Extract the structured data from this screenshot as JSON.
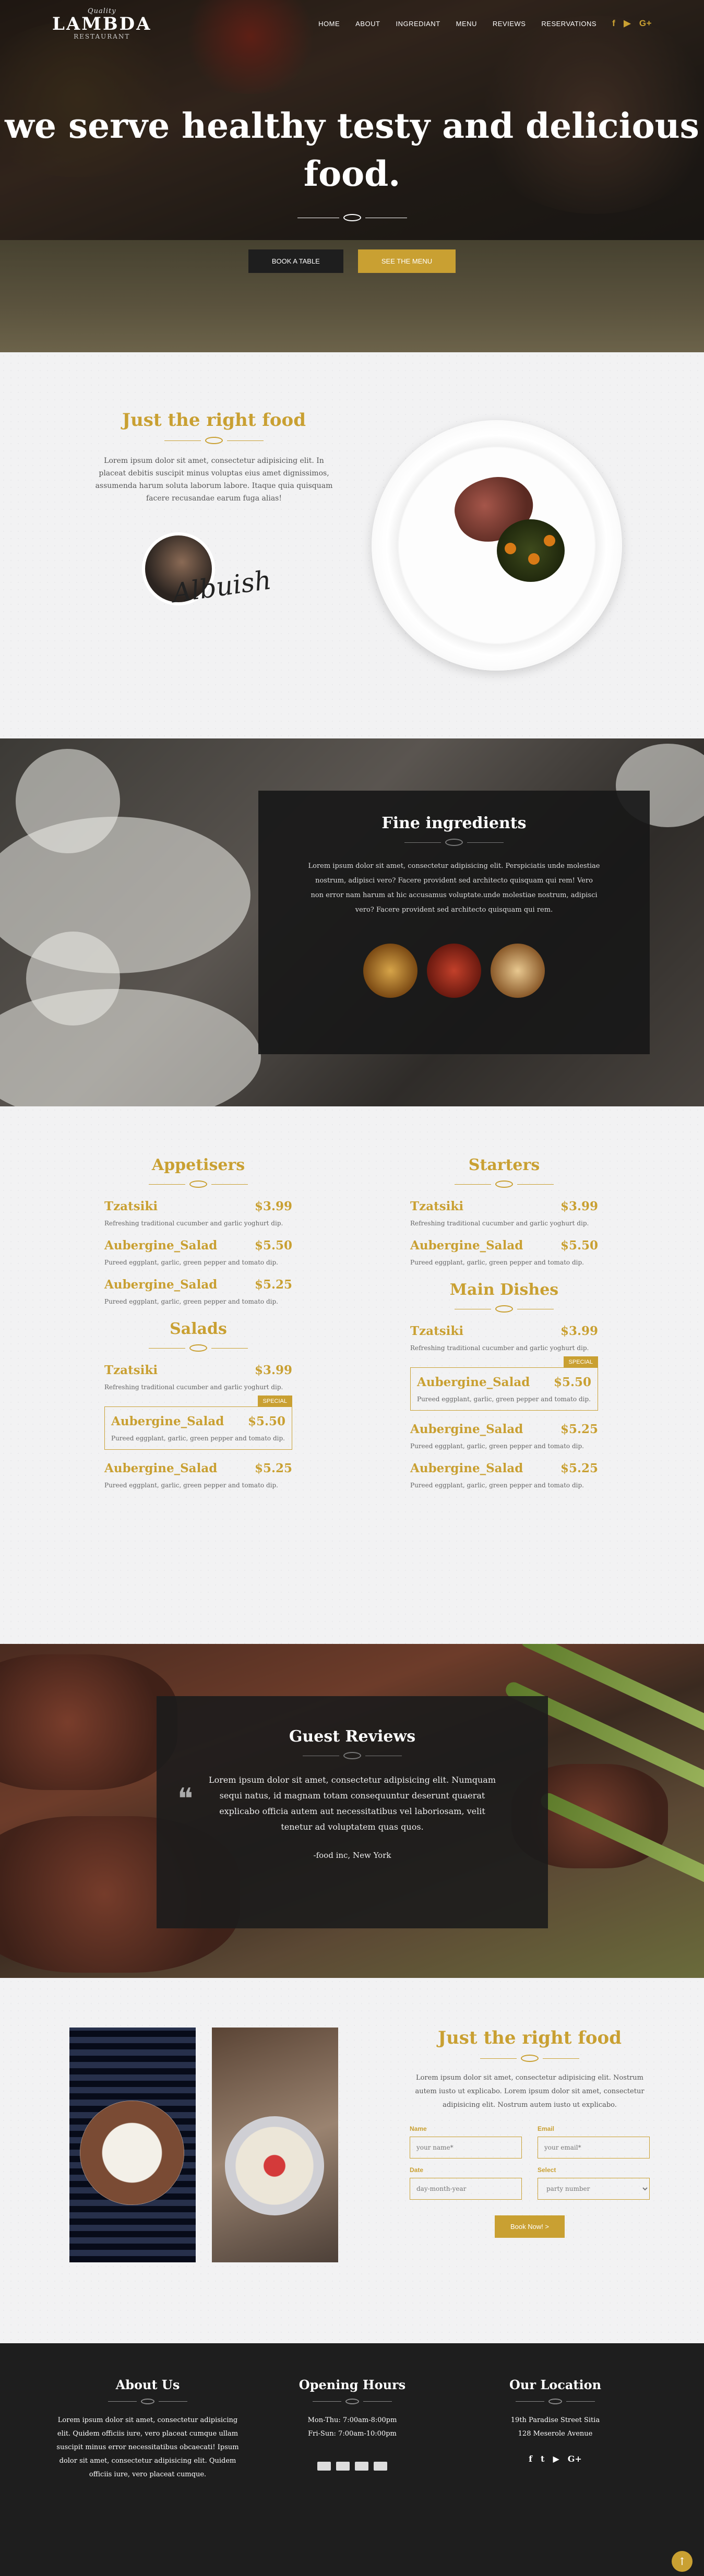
{
  "brand": {
    "sub1": "Quality",
    "name": "LAMBDA",
    "sub2": "RESTAURANT"
  },
  "nav": {
    "items": [
      "HOME",
      "ABOUT",
      "INGREDIANT",
      "MENU",
      "REVIEWS",
      "RESERVATIONS"
    ],
    "social": [
      "f",
      "▶",
      "G+"
    ]
  },
  "hero": {
    "title": "we serve healthy testy and delicious food.",
    "book_button": "BOOK A TABLE",
    "menu_button": "SEE THE MENU"
  },
  "about": {
    "title": "Just the right food",
    "text": "Lorem ipsum dolor sit amet, consectetur adipisicing elit. In placeat debitis suscipit minus voluptas eius amet dignissimos, assumenda harum soluta laborum labore. Itaque quia quisquam facere recusandae earum fuga alias!",
    "signature": "Albuish"
  },
  "ingredients": {
    "title": "Fine ingredients",
    "text": "Lorem ipsum dolor sit amet, consectetur adipisicing elit. Perspiciatis unde molestiae nostrum, adipisci vero? Facere provident sed architecto quisquam qui rem! Vero non error nam harum at hic accusamus voluptate.unde molestiae nostrum, adipisci vero? Facere provident sed architecto quisquam qui rem."
  },
  "menu": {
    "appetisers": {
      "title": "Appetisers",
      "items": [
        {
          "name": "Tzatsiki",
          "price": "$3.99",
          "desc": "Refreshing traditional cucumber and garlic yoghurt dip."
        },
        {
          "name": "Aubergine_Salad",
          "price": "$5.50",
          "desc": "Pureed eggplant, garlic, green pepper and tomato dip."
        },
        {
          "name": "Aubergine_Salad",
          "price": "$5.25",
          "desc": "Pureed eggplant, garlic, green pepper and tomato dip."
        }
      ]
    },
    "salads": {
      "title": "Salads",
      "items": [
        {
          "name": "Tzatsiki",
          "price": "$3.99",
          "desc": "Refreshing traditional cucumber and garlic yoghurt dip."
        },
        {
          "name": "Aubergine_Salad",
          "price": "$5.50",
          "desc": "Pureed eggplant, garlic, green pepper and tomato dip.",
          "tag": "SPECIAL"
        },
        {
          "name": "Aubergine_Salad",
          "price": "$5.25",
          "desc": "Pureed eggplant, garlic, green pepper and tomato dip."
        }
      ]
    },
    "starters": {
      "title": "Starters",
      "items": [
        {
          "name": "Tzatsiki",
          "price": "$3.99",
          "desc": "Refreshing traditional cucumber and garlic yoghurt dip."
        },
        {
          "name": "Aubergine_Salad",
          "price": "$5.50",
          "desc": "Pureed eggplant, garlic, green pepper and tomato dip."
        }
      ]
    },
    "main": {
      "title": "Main Dishes",
      "items": [
        {
          "name": "Tzatsiki",
          "price": "$3.99",
          "desc": "Refreshing traditional cucumber and garlic yoghurt dip."
        },
        {
          "name": "Aubergine_Salad",
          "price": "$5.50",
          "desc": "Pureed eggplant, garlic, green pepper and tomato dip.",
          "tag": "SPECIAL"
        },
        {
          "name": "Aubergine_Salad",
          "price": "$5.25",
          "desc": "Pureed eggplant, garlic, green pepper and tomato dip."
        },
        {
          "name": "Aubergine_Salad",
          "price": "$5.25",
          "desc": "Pureed eggplant, garlic, green pepper and tomato dip."
        }
      ]
    }
  },
  "reviews": {
    "title": "Guest Reviews",
    "quote_mark": "❝",
    "text": "Lorem ipsum dolor sit amet, consectetur adipisicing elit. Numquam sequi natus, id magnam totam consequuntur deserunt quaerat explicabo officia autem aut necessitatibus vel laboriosam, velit tenetur ad voluptatem quas quos.",
    "author": "-food inc, New York"
  },
  "booking": {
    "title": "Just the right food",
    "text": "Lorem ipsum dolor sit amet, consectetur adipisicing elit. Nostrum autem iusto ut explicabo. Lorem ipsum dolor sit amet, consectetur adipisicing elit. Nostrum autem iusto ut explicabo.",
    "name_label": "Name",
    "name_placeholder": "your name*",
    "email_label": "Email",
    "email_placeholder": "your email*",
    "date_label": "Date",
    "date_placeholder": "day-month-year",
    "select_label": "Select",
    "select_value": "party number",
    "submit": "Book Now! >"
  },
  "footer": {
    "about_title": "About Us",
    "about_text": "Lorem ipsum dolor sit amet, consectetur adipisicing elit. Quidem officiis iure, vero placeat cumque ullam suscipit minus error necessitatibus obcaecati! Ipsum dolor sit amet, consectetur adipisicing elit. Quidem officiis iure, vero placeat cumque.",
    "hours_title": "Opening Hours",
    "hours_1": "Mon-Thu: 7:00am-8:00pm",
    "hours_2": "Fri-Sun: 7:00am-10:00pm",
    "location_title": "Our Location",
    "address_1": "19th Paradise Street Sitia",
    "address_2": "128 Meserole Avenue",
    "social": [
      "f",
      "t",
      "▶",
      "G+"
    ],
    "back_to_top": "↑"
  },
  "colors": {
    "accent": "#c9a032",
    "dark": "#1e1e1e"
  }
}
